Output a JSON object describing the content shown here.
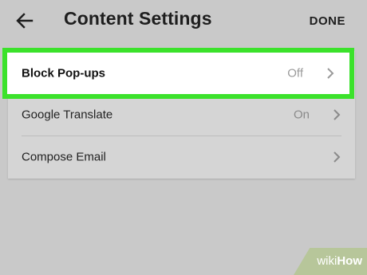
{
  "header": {
    "title": "Content Settings",
    "done_label": "DONE"
  },
  "settings": {
    "items": [
      {
        "label": "Block Pop-ups",
        "value": "Off"
      },
      {
        "label": "Google Translate",
        "value": "On"
      },
      {
        "label": "Compose Email",
        "value": ""
      }
    ]
  },
  "watermark": {
    "wiki": "wiki",
    "how": "How"
  },
  "icons": {
    "back": "back-arrow-icon",
    "chevron": "chevron-right-icon"
  },
  "colors": {
    "highlight": "#3be22b",
    "background": "#c9c9c9"
  }
}
